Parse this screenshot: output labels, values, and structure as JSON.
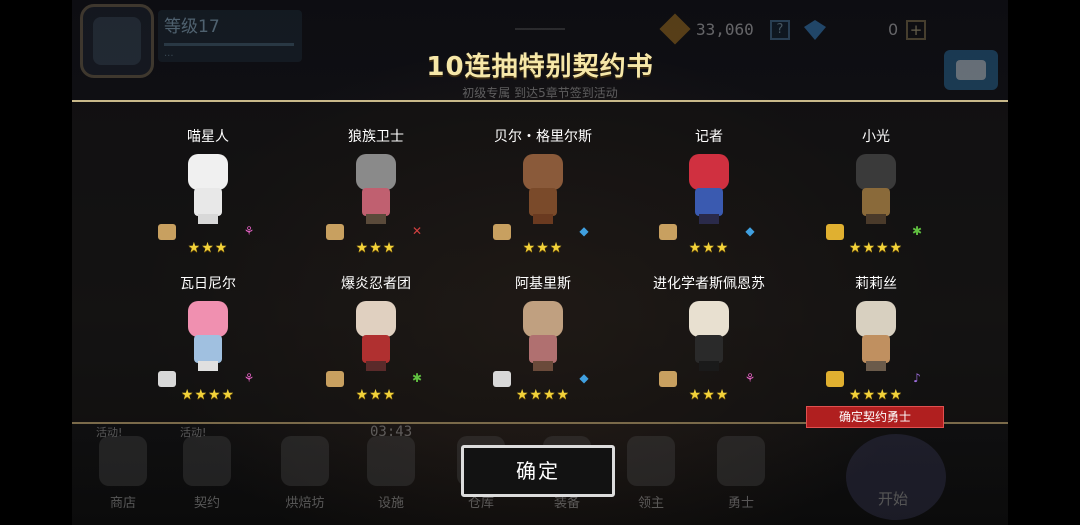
{
  "hud": {
    "level": "等级17",
    "level_sub": "...",
    "gold": "33,060",
    "gold_help": "?",
    "gems": "0",
    "gem_help": "?",
    "plus": "+"
  },
  "modal": {
    "title": "10连抽特别契约书",
    "subtitle": "初级专属  到达5章节签到活动",
    "confirm_hero_label": "确定契约勇士",
    "confirm_button": "确定"
  },
  "heroes": [
    {
      "name": "喵星人",
      "stars": "★★★",
      "rating": 3,
      "sprite": "cat-sprite",
      "class_icon": "mage-icon",
      "class_glyph": "⚘",
      "class_color": "#e060c0",
      "scroll_color": "#c8a060",
      "head": "#f0f0f0",
      "body": "#e8e8e8",
      "legs": "#d8d8d8"
    },
    {
      "name": "狼族卫士",
      "stars": "★★★",
      "rating": 3,
      "sprite": "wolf-guard-sprite",
      "class_icon": "sword-icon",
      "class_glyph": "✕",
      "class_color": "#d04040",
      "scroll_color": "#c8a060",
      "head": "#8a8a8a",
      "body": "#c06070",
      "legs": "#5a4a3a"
    },
    {
      "name": "贝尔・格里尔斯",
      "stars": "★★★",
      "rating": 3,
      "sprite": "bear-sprite",
      "class_icon": "shield-icon",
      "class_glyph": "◆",
      "class_color": "#40a0e0",
      "scroll_color": "#c8a060",
      "head": "#8a5a3a",
      "body": "#7a4a2a",
      "legs": "#6a3a20"
    },
    {
      "name": "记者",
      "stars": "★★★",
      "rating": 3,
      "sprite": "reporter-sprite",
      "class_icon": "shield-icon",
      "class_glyph": "◆",
      "class_color": "#40a0e0",
      "scroll_color": "#c8a060",
      "head": "#d03040",
      "body": "#3a5ab0",
      "legs": "#2a2a4a"
    },
    {
      "name": "小光",
      "stars": "★★★★",
      "rating": 4,
      "sprite": "xiaoguang-sprite",
      "class_icon": "support-icon",
      "class_glyph": "✱",
      "class_color": "#60c040",
      "scroll_color": "#e0b030",
      "head": "#3a3a3a",
      "body": "#8a6a3a",
      "legs": "#4a3a2a"
    },
    {
      "name": "瓦日尼尔",
      "stars": "★★★★",
      "rating": 4,
      "sprite": "varinir-sprite",
      "class_icon": "mage-icon",
      "class_glyph": "⚘",
      "class_color": "#e060c0",
      "scroll_color": "#d8d8d8",
      "head": "#f090b0",
      "body": "#a0c0e0",
      "legs": "#e0e0e0"
    },
    {
      "name": "爆炎忍者团",
      "stars": "★★★",
      "rating": 3,
      "sprite": "ninja-sprite",
      "class_icon": "support-icon",
      "class_glyph": "✱",
      "class_color": "#60c040",
      "scroll_color": "#c8a060",
      "head": "#e0d0c0",
      "body": "#b03030",
      "legs": "#5a2a2a"
    },
    {
      "name": "阿基里斯",
      "stars": "★★★★",
      "rating": 4,
      "sprite": "achilles-sprite",
      "class_icon": "shield-icon",
      "class_glyph": "◆",
      "class_color": "#40a0e0",
      "scroll_color": "#d8d8d8",
      "head": "#c0a080",
      "body": "#b07070",
      "legs": "#6a4a3a"
    },
    {
      "name": "进化学者斯佩恩苏",
      "stars": "★★★",
      "rating": 3,
      "sprite": "scholar-sprite",
      "class_icon": "mage-icon",
      "class_glyph": "⚘",
      "class_color": "#e060c0",
      "scroll_color": "#c8a060",
      "head": "#e8e0d0",
      "body": "#2a2a2a",
      "legs": "#1a1a1a"
    },
    {
      "name": "莉莉丝",
      "stars": "★★★★",
      "rating": 4,
      "sprite": "lilith-sprite",
      "class_icon": "wand-icon",
      "class_glyph": "♪",
      "class_color": "#a070e0",
      "scroll_color": "#e0b030",
      "head": "#d8d0c0",
      "body": "#c09060",
      "legs": "#6a5a4a"
    }
  ],
  "bottom_nav": {
    "timer": "03:43",
    "items": [
      {
        "label": "商店",
        "badge": "活动!"
      },
      {
        "label": "契约",
        "badge": "活动!"
      },
      {
        "label": "烘焙坊",
        "badge": ""
      },
      {
        "label": "设施",
        "badge": ""
      },
      {
        "label": "仓库",
        "badge": ""
      },
      {
        "label": "装备",
        "badge": ""
      },
      {
        "label": "领主",
        "badge": ""
      },
      {
        "label": "勇士",
        "badge": ""
      }
    ],
    "start": "开始"
  }
}
